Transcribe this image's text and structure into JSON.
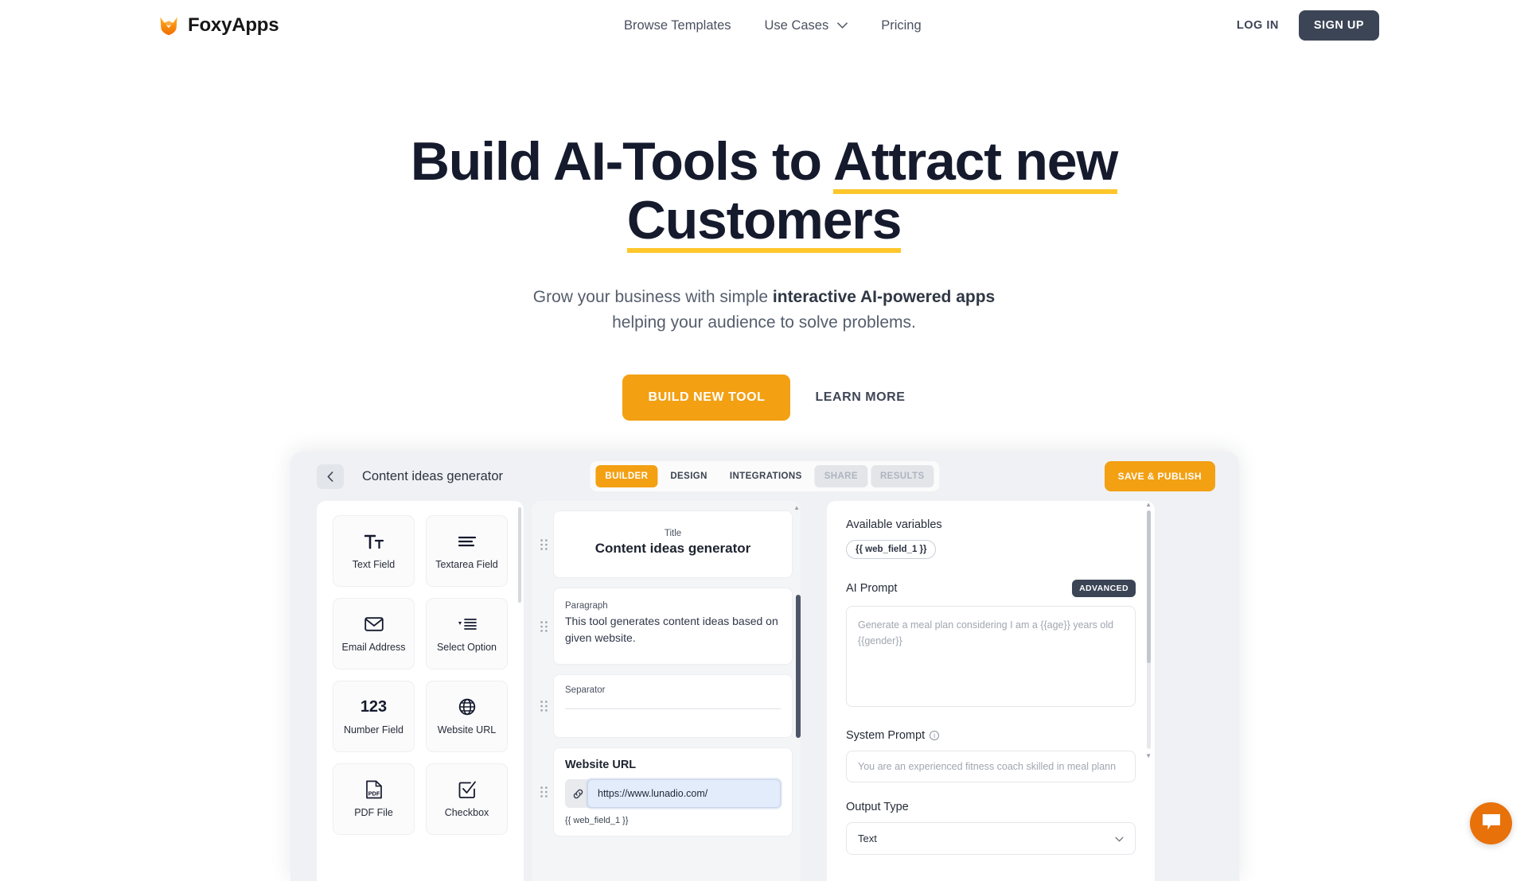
{
  "nav": {
    "brand": "FoxyApps",
    "brand_icon": "fox-logo-icon",
    "links": [
      {
        "label": "Browse Templates",
        "has_caret": false
      },
      {
        "label": "Use Cases",
        "has_caret": true
      },
      {
        "label": "Pricing",
        "has_caret": false
      }
    ],
    "login_label": "LOG IN",
    "signup_label": "SIGN UP",
    "signup_bg": "#3c4556"
  },
  "hero": {
    "title_part1": "Build AI-Tools to ",
    "title_highlight1": "Attract new",
    "title_highlight2": "Customers",
    "highlight_color": "#ffc62b",
    "sub_part1": "Grow your business with simple ",
    "sub_bold": "interactive AI-powered apps",
    "sub_part2": "helping your audience to solve problems.",
    "cta_primary": "BUILD NEW TOOL",
    "cta_primary_bg": "#f3a013",
    "cta_secondary": "LEARN MORE"
  },
  "app": {
    "back_icon": "chevron-left-icon",
    "title": "Content ideas generator",
    "tabs": [
      {
        "label": "BUILDER",
        "state": "active"
      },
      {
        "label": "DESIGN",
        "state": "normal"
      },
      {
        "label": "INTEGRATIONS",
        "state": "normal"
      },
      {
        "label": "SHARE",
        "state": "disabled"
      },
      {
        "label": "RESULTS",
        "state": "disabled"
      }
    ],
    "publish_label": "SAVE & PUBLISH",
    "palette": [
      {
        "label": "Text Field",
        "icon": "text-format-icon",
        "glyph": "Tт"
      },
      {
        "label": "Textarea Field",
        "icon": "lines-icon",
        "glyph": ""
      },
      {
        "label": "Email Address",
        "icon": "envelope-icon",
        "glyph": ""
      },
      {
        "label": "Select Option",
        "icon": "dropdown-list-icon",
        "glyph": ""
      },
      {
        "label": "Number Field",
        "icon": "number-icon",
        "glyph": "123"
      },
      {
        "label": "Website URL",
        "icon": "globe-icon",
        "glyph": ""
      },
      {
        "label": "PDF File",
        "icon": "pdf-file-icon",
        "glyph": "PDF"
      },
      {
        "label": "Checkbox",
        "icon": "checkbox-icon",
        "glyph": ""
      }
    ],
    "canvas": {
      "title_kicker": "Title",
      "title_value": "Content ideas generator",
      "paragraph_kicker": "Paragraph",
      "paragraph_value": "This tool generates content ideas based on given website.",
      "separator_kicker": "Separator",
      "url_label": "Website URL",
      "url_value": "https://www.lunadio.com/",
      "url_icon": "link-icon",
      "url_variable": "{{ web_field_1 }}"
    },
    "settings": {
      "available_variables_label": "Available variables",
      "variable_chip": "{{ web_field_1 }}",
      "ai_prompt_label": "AI Prompt",
      "advanced_badge": "ADVANCED",
      "ai_prompt_placeholder": "Generate a meal plan considering I am a {{age}} years old {{gender}}",
      "system_prompt_label": "System Prompt",
      "system_prompt_info_icon": "info-icon",
      "system_prompt_placeholder": "You are an experienced fitness coach skilled in meal plann",
      "output_type_label": "Output Type",
      "output_type_value": "Text"
    }
  },
  "chat": {
    "icon": "chat-bubble-icon",
    "color": "#e8710a"
  }
}
